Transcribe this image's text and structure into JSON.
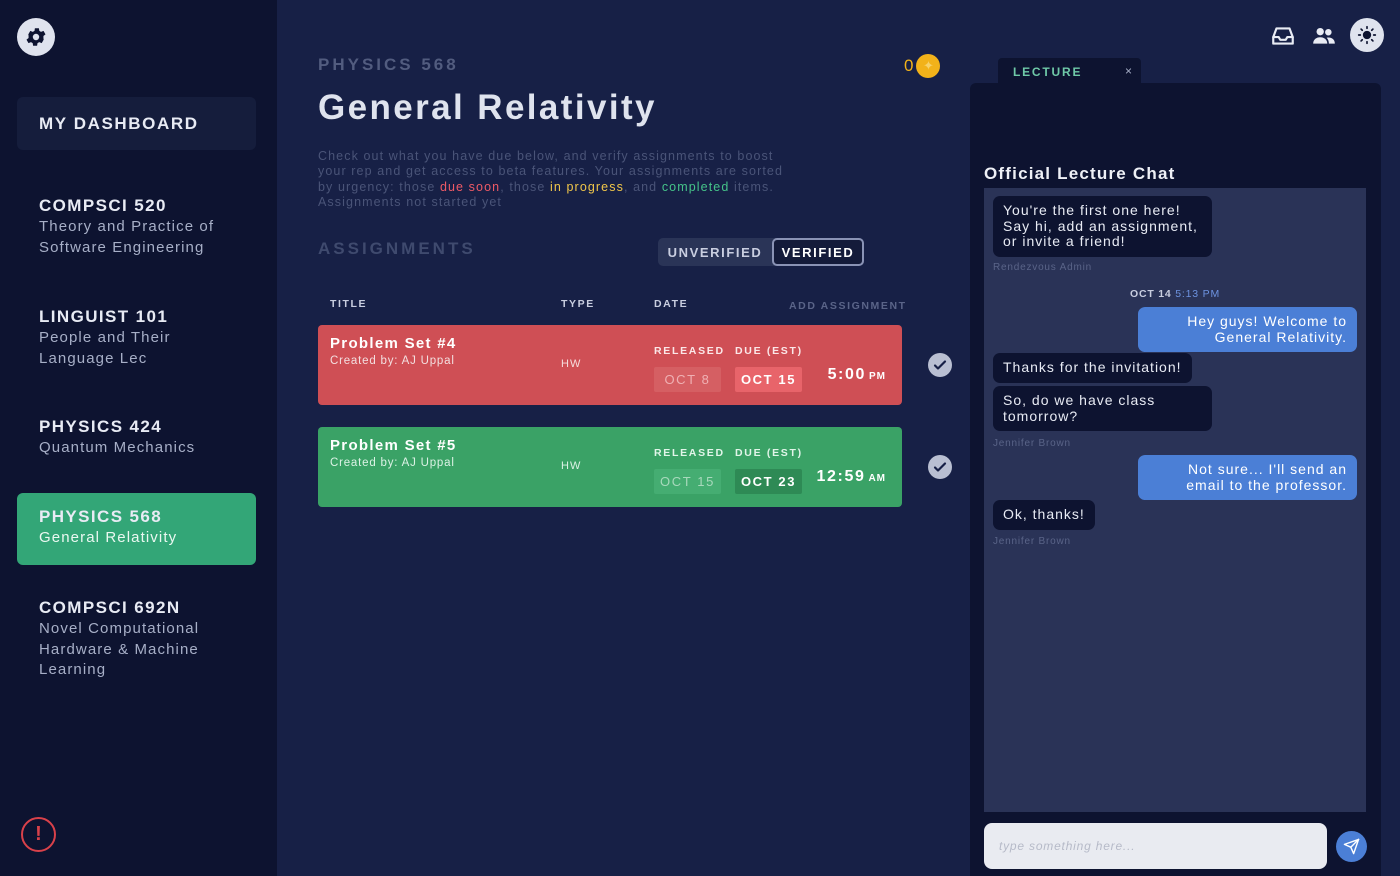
{
  "sidebar": {
    "dashboard_label": "MY DASHBOARD",
    "courses": [
      {
        "code": "COMPSCI 520",
        "name": "Theory and Practice of Software Engineering"
      },
      {
        "code": "LINGUIST 101",
        "name": "People and Their Language Lec"
      },
      {
        "code": "PHYSICS 424",
        "name": "Quantum Mechanics"
      },
      {
        "code": "PHYSICS 568",
        "name": "General Relativity"
      },
      {
        "code": "COMPSCI 692N",
        "name": "Novel Computational Hardware & Machine Learning"
      }
    ],
    "alert_glyph": "!"
  },
  "main": {
    "course_code": "PHYSICS 568",
    "title": "General Relativity",
    "description": {
      "p1": "Check out what you have due below, and verify assignments to boost your rep and get access to beta features. Your assignments are sorted by urgency: those ",
      "due_soon": "due soon",
      "p2": ", those ",
      "in_progress": "in progress",
      "p3": ", and ",
      "completed": "completed",
      "p4": " items. Assignments not started yet"
    },
    "rep": "0",
    "assignments_heading": "ASSIGNMENTS",
    "toggle": {
      "unverified": "UNVERIFIED",
      "verified": "VERIFIED"
    },
    "columns": {
      "title": "TITLE",
      "type": "TYPE",
      "date": "DATE",
      "add": "ADD ASSIGNMENT"
    },
    "assignments": [
      {
        "title": "Problem Set #4",
        "creator": "Created by: AJ Uppal",
        "type": "HW",
        "released_label": "RELEASED",
        "due_label": "DUE (EST)",
        "released": "OCT 8",
        "due": "OCT 15",
        "time": "5:00",
        "ampm": "PM",
        "status_color": "#cf4f55"
      },
      {
        "title": "Problem Set #5",
        "creator": "Created by: AJ Uppal",
        "type": "HW",
        "released_label": "RELEASED",
        "due_label": "DUE (EST)",
        "released": "OCT 15",
        "due": "OCT 23",
        "time": "12:59",
        "ampm": "AM",
        "status_color": "#3aa266"
      }
    ]
  },
  "header": {
    "icons": [
      "inbox-icon",
      "users-icon",
      "sun-icon"
    ]
  },
  "chat": {
    "tab_label": "LECTURE",
    "tab_close": "×",
    "title": "Official Lecture Chat",
    "messages": [
      {
        "text": "You're the first one here! Say hi, add an assignment, or invite a friend!",
        "sender": "Rendezvous Admin"
      },
      {
        "text": "Hey guys! Welcome to General Relativity."
      },
      {
        "text": "Thanks for the invitation!"
      },
      {
        "text": "So, do we have class tomorrow?",
        "sender": "Jennifer Brown"
      },
      {
        "text": "Not sure... I'll send an email to the professor."
      },
      {
        "text": "Ok, thanks!",
        "sender": "Jennifer Brown"
      }
    ],
    "date_label": "OCT 14",
    "date_time": "5:13 PM",
    "input_placeholder": "type something here..."
  },
  "colors": {
    "background": "#172046",
    "sidebar": "#0d1330",
    "active_course": "#33a677",
    "due_soon": "#ee5a66",
    "in_progress": "#f0c64a",
    "completed": "#45c389",
    "accent_blue": "#4b7fd6",
    "coin": "#f2b21a"
  }
}
